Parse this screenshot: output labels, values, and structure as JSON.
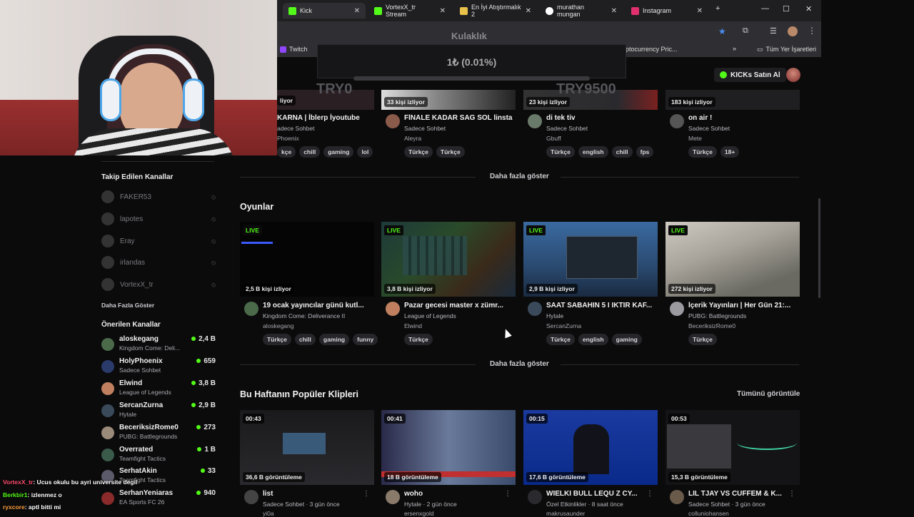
{
  "browser": {
    "tabs": [
      {
        "label": "Kick",
        "color": "#53fc18"
      },
      {
        "label": "VortexX_tr Stream",
        "color": "#53fc18"
      },
      {
        "label": "En İyi Atıştırmalık 2",
        "color": "#e8c14a"
      },
      {
        "label": "murathan mungan",
        "color": "#ffffff"
      },
      {
        "label": "Instagram",
        "color": "#e1306c"
      }
    ],
    "bookmarks": {
      "first": "Twitch",
      "crypto": "ptocurrency Pric...",
      "all": "Tüm Yer İşaretleri"
    }
  },
  "overlay": {
    "title": "Kulaklık",
    "rate": "1₺ (0.01%)",
    "min": "TRY0",
    "max": "TRY9500"
  },
  "header": {
    "buy_label": "KICKs Satın Al"
  },
  "top_row": {
    "cards": [
      {
        "title": "KARNA | İblerp İyoutube",
        "category": "adece Sohbet",
        "user": "Phoenix",
        "viewers": "",
        "tags": [
          "kçe",
          "chill",
          "gaming",
          "lol"
        ]
      },
      {
        "title": "FİNALE KADAR SAG SOL İinsta",
        "category": "Sadece Sohbet",
        "user": "Aleyra",
        "viewers": "33 kişi izliyor",
        "tags": [
          "Türkçe",
          "Türkçe"
        ]
      },
      {
        "title": "di tek tiv",
        "category": "Sadece Sohbet",
        "user": "Gbuff",
        "viewers": "23 kişi izliyor",
        "tags": [
          "Türkçe",
          "english",
          "chill",
          "fps"
        ]
      },
      {
        "title": "on air !",
        "category": "Sadece Sohbet",
        "user": "Mete",
        "viewers": "183 kişi izliyor",
        "tags": [
          "Türkçe",
          "18+"
        ]
      }
    ],
    "first_viewers_fragment": "liyor",
    "more": "Daha fazla göster"
  },
  "games": {
    "title": "Oyunlar",
    "live_label": "LIVE",
    "cards": [
      {
        "title": "19 ocak yayıncılar günü kutl...",
        "category": "Kingdom Come: Deliverance II",
        "user": "aloskegang",
        "viewers": "2,5 B kişi izliyor",
        "tags": [
          "Türkçe",
          "chill",
          "gaming",
          "funny"
        ]
      },
      {
        "title": "Pazar gecesi master x zümr...",
        "category": "League of Legends",
        "user": "Elwind",
        "viewers": "3,8 B kişi izliyor",
        "tags": [
          "Türkçe"
        ]
      },
      {
        "title": "SAAT SABAHIN 5 I IKTIR KAF...",
        "category": "Hytale",
        "user": "SercanZurna",
        "viewers": "2,9 B kişi izliyor",
        "tags": [
          "Türkçe",
          "english",
          "gaming"
        ]
      },
      {
        "title": "İçerik Yayınları | Her Gün 21:...",
        "category": "PUBG: Battlegrounds",
        "user": "BeceriksizRome0",
        "viewers": "272 kişi izliyor",
        "tags": [
          "Türkçe"
        ]
      }
    ],
    "more": "Daha fazla göster"
  },
  "clips": {
    "title": "Bu Haftanın Popüler Klipleri",
    "see_all": "Tümünü görüntüle",
    "cards": [
      {
        "duration": "00:43",
        "views": "36,6 B görüntüleme",
        "title": "list",
        "meta": "Sadece Sohbet · 3 gün önce",
        "user": "yi0a"
      },
      {
        "duration": "00:41",
        "views": "18 B görüntüleme",
        "title": "woho",
        "meta": "Hytale · 2 gün önce",
        "user": "ersenxgold"
      },
      {
        "duration": "00:15",
        "views": "17,6 B görüntüleme",
        "title": "WIELKI BULL LEQU Z CY...",
        "meta": "Özel Etkinlikler · 8 saat önce",
        "user": "makrusaunder"
      },
      {
        "duration": "00:53",
        "views": "15,3 B görüntüleme",
        "title": "LIL TJAY VS CUFFEM & K...",
        "meta": "Sadece Sohbet · 3 gün önce",
        "user": "colluniohansen"
      }
    ]
  },
  "sidebar": {
    "followed_title": "Takip Edilen Kanallar",
    "followed": [
      "FAKER53",
      "lapotes",
      "Eray",
      "irlandas",
      "VortexX_tr"
    ],
    "followed_more": "Daha Fazla Göster",
    "recommended_title": "Önerilen Kanallar",
    "recommended": [
      {
        "name": "aloskegang",
        "sub": "Kingdom Come: Deli...",
        "count": "2,4 B"
      },
      {
        "name": "HolyPhoenix",
        "sub": "Sadece Sohbet",
        "count": "659"
      },
      {
        "name": "Elwind",
        "sub": "League of Legends",
        "count": "3,8 B"
      },
      {
        "name": "SercanZurna",
        "sub": "Hytale",
        "count": "2,9 B"
      },
      {
        "name": "BeceriksizRome0",
        "sub": "PUBG: Battlegrounds",
        "count": "273"
      },
      {
        "name": "Overrated",
        "sub": "Teamfight Tactics",
        "count": "1 B"
      },
      {
        "name": "SerhatAkin",
        "sub": "Teamfight Tactics",
        "count": "33"
      },
      {
        "name": "SerhanYeniaras",
        "sub": "EA Sports FC 26",
        "count": "940"
      }
    ]
  },
  "chat": [
    {
      "user": "VortexX_tr",
      "color": "#ff4d6d",
      "msg": ": Ucus okulu bu ayri universite degil"
    },
    {
      "user": "Berkbir1",
      "color": "#53fc18",
      "msg": ": izlenmez o"
    },
    {
      "user": "ryxcore",
      "color": "#ff9f40",
      "msg": ": aptl bitti mi"
    }
  ]
}
